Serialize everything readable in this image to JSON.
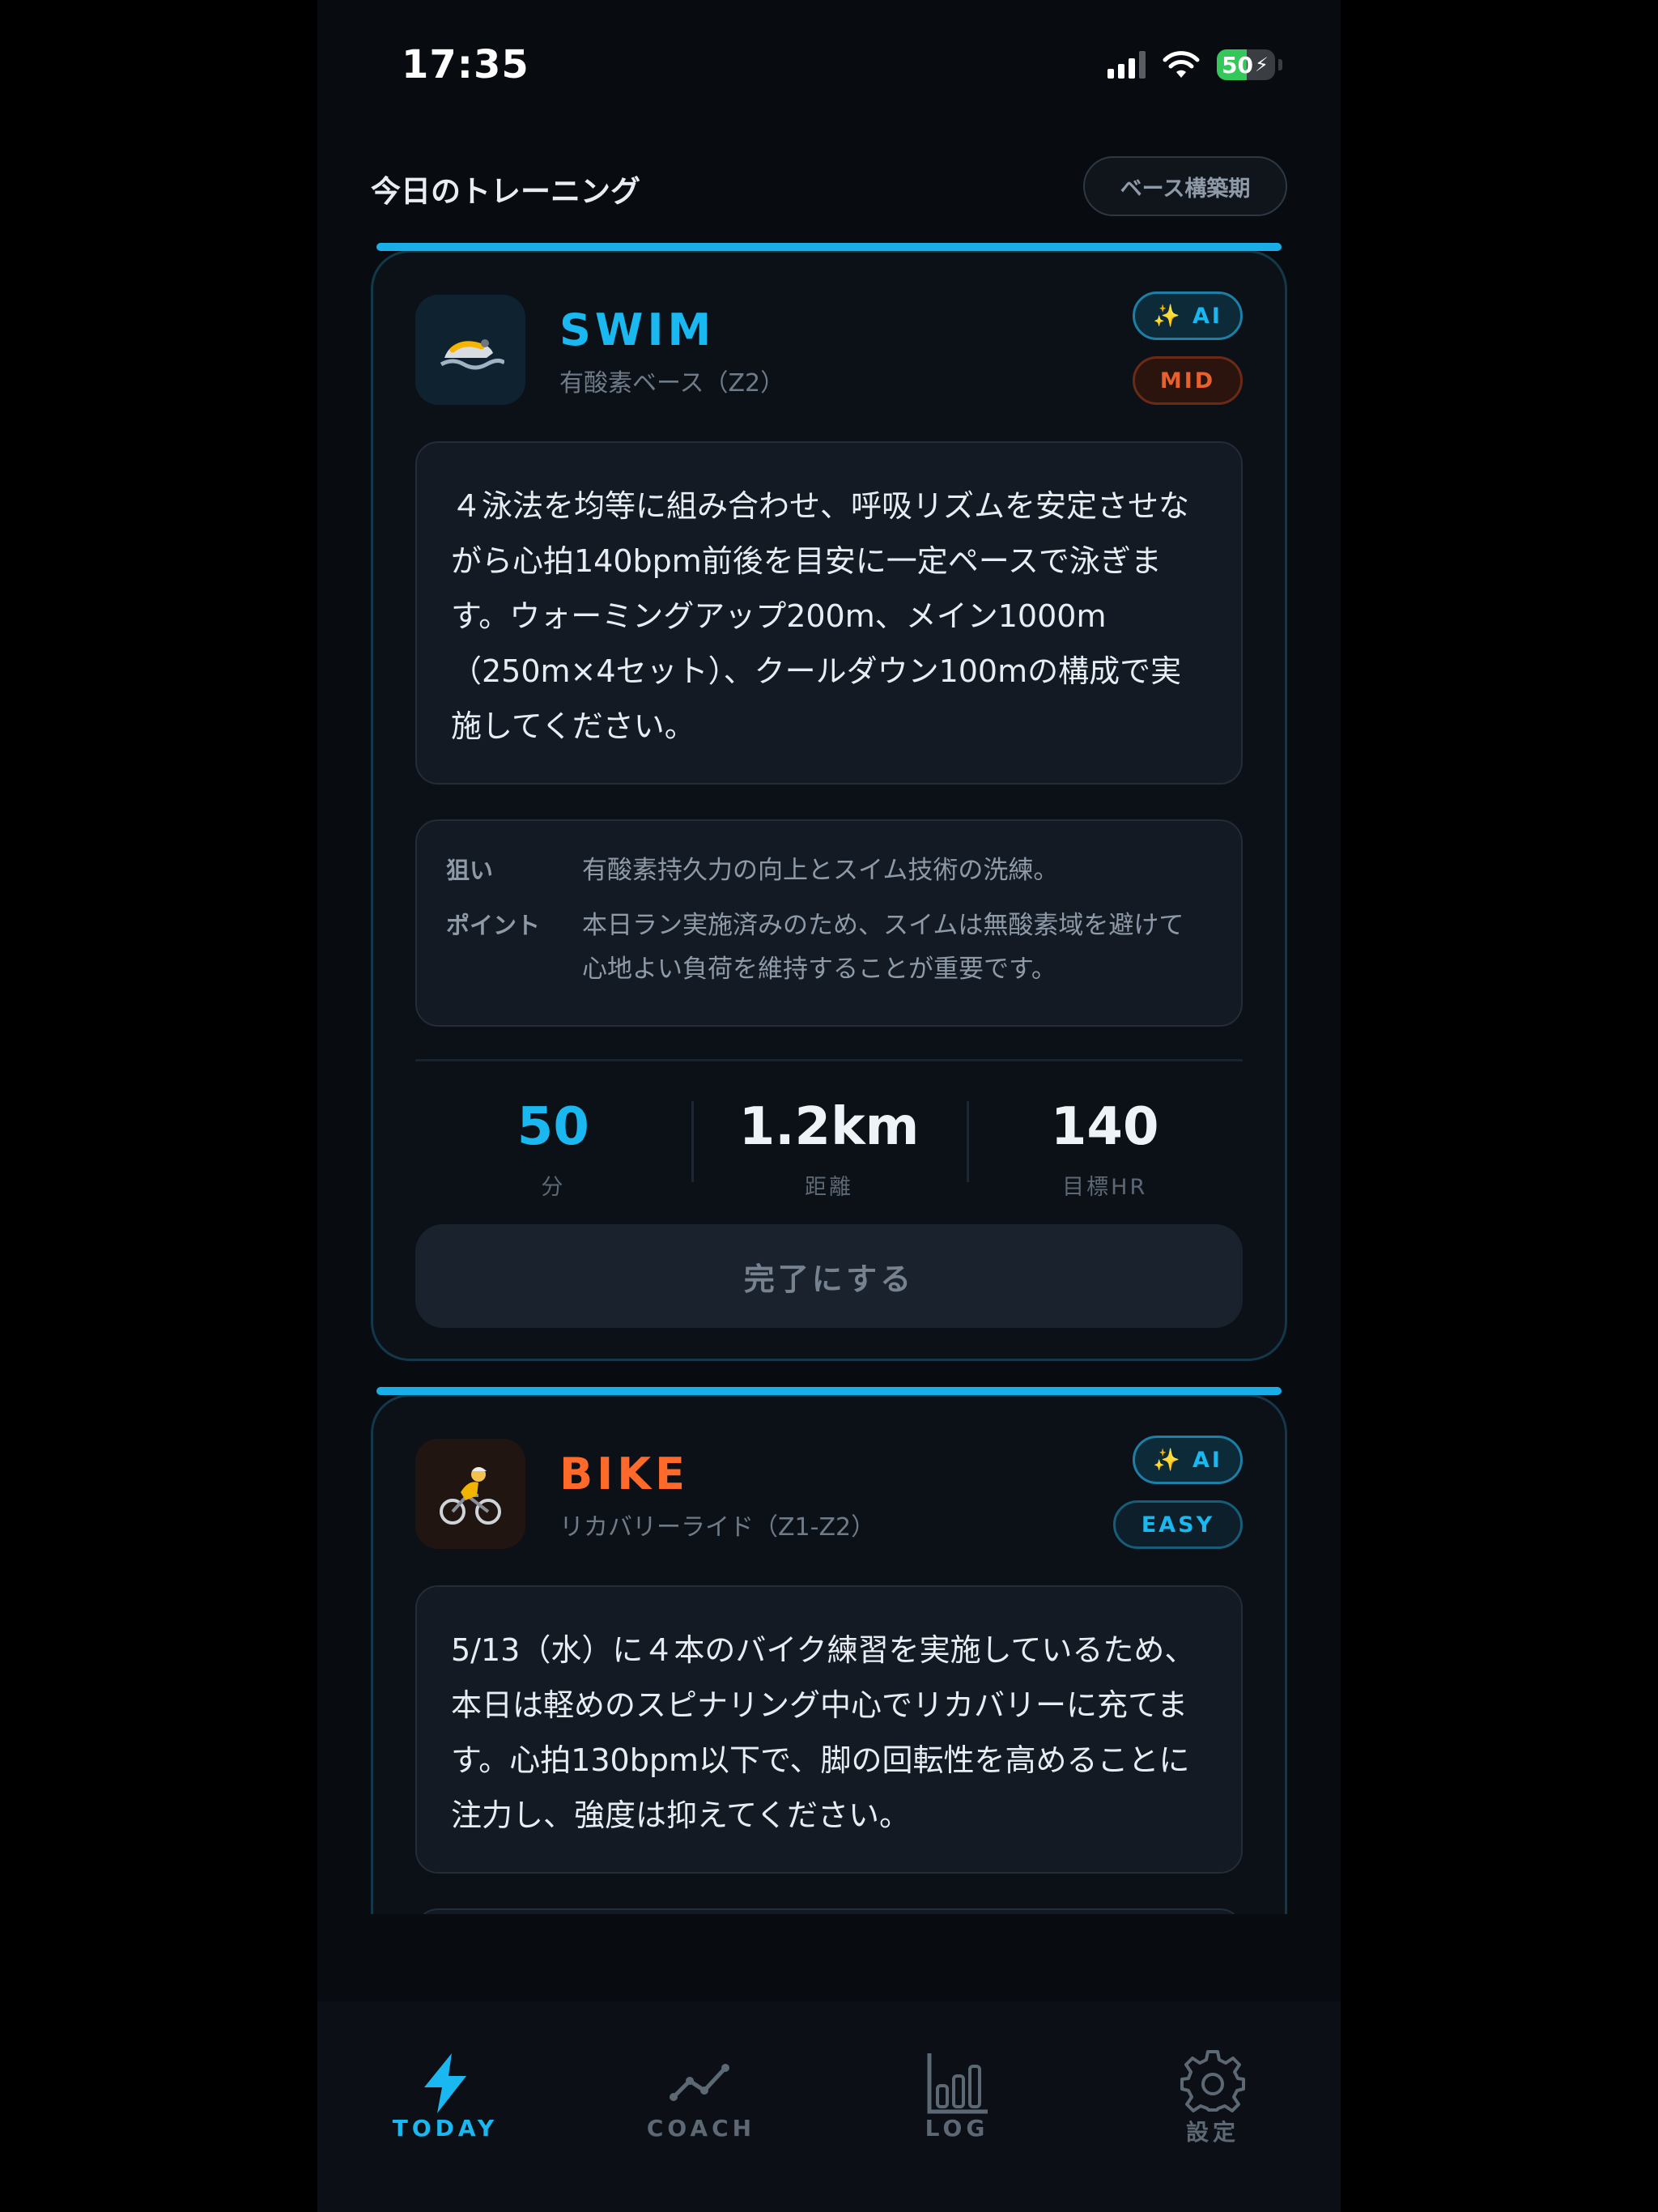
{
  "status_bar": {
    "time": "17:35",
    "battery": "50"
  },
  "header": {
    "title": "今日のトレーニング",
    "phase": "ベース構築期"
  },
  "cards": [
    {
      "sport": "SWIM",
      "subtitle": "有酸素ベース（Z2）",
      "icon": "🩴",
      "icon_name": "swim-goggles-icon",
      "accent": "#1ab8f0",
      "badges": {
        "ai": "✨ AI",
        "intensity": "MID"
      },
      "description": "４泳法を均等に組み合わせ、呼吸リズムを安定させながら心拍140bpm前後を目安に一定ペースで泳ぎます。ウォーミングアップ200m、メイン1000m（250m×4セット）、クールダウン100mの構成で実施してください。",
      "info": [
        {
          "key": "狙い",
          "value": "有酸素持久力の向上とスイム技術の洗練。"
        },
        {
          "key": "ポイント",
          "value": "本日ラン実施済みのため、スイムは無酸素域を避けて心地よい負荷を維持することが重要です。"
        }
      ],
      "stats": [
        {
          "value": "50",
          "label": "分"
        },
        {
          "value": "1.2km",
          "label": "距離"
        },
        {
          "value": "140",
          "label": "目標HR"
        }
      ],
      "button": "完了にする"
    },
    {
      "sport": "BIKE",
      "subtitle": "リカバリーライド（Z1-Z2）",
      "icon": "🚴",
      "icon_name": "cyclist-icon",
      "accent": "#ff6a2b",
      "badges": {
        "ai": "✨ AI",
        "intensity": "EASY"
      },
      "description": "5/13（水）に４本のバイク練習を実施しているため、本日は軽めのスピナリング中心でリカバリーに充てます。心拍130bpm以下で、脚の回転性を高めることに注力し、強度は抑えてください。"
    }
  ],
  "tabs": [
    {
      "label": "TODAY",
      "active": true
    },
    {
      "label": "COACH",
      "active": false
    },
    {
      "label": "LOG",
      "active": false
    },
    {
      "label": "設定",
      "active": false
    }
  ],
  "colors": {
    "primary": "#1ab8f0",
    "bike": "#ff6a2b",
    "mid": "#e8602c",
    "background": "#080b10"
  }
}
